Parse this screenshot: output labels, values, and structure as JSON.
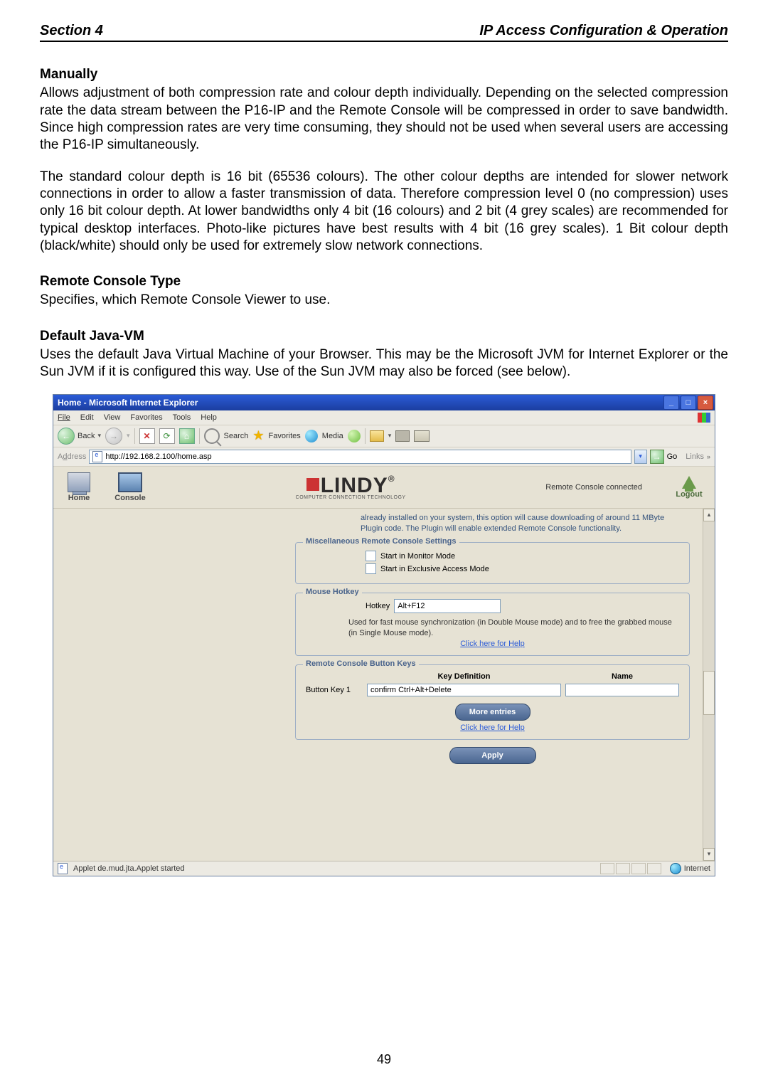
{
  "header": {
    "left": "Section 4",
    "right": "IP Access Configuration & Operation"
  },
  "page_number": "49",
  "sections": {
    "manually": {
      "title": "Manually",
      "para": "Allows adjustment of both compression rate and colour depth individually. Depending on the selected compression rate the data stream between the P16-IP and the Remote Console will be compressed in order to save bandwidth. Since high compression rates are very time consuming, they should not be used when several users are accessing the P16-IP simultaneously.",
      "para2": "The standard colour depth is 16 bit (65536 colours). The other colour depths are intended for slower network connections in order to allow a faster transmission of data. Therefore compression level 0 (no compression) uses only 16 bit colour depth. At lower bandwidths only 4 bit (16 colours) and 2 bit (4 grey scales) are recommended for typical desktop interfaces. Photo-like pictures have best results with 4 bit (16 grey scales). 1 Bit colour depth (black/white) should only be used for extremely slow network connections."
    },
    "remote_console_type": {
      "title": "Remote Console Type",
      "para": "Specifies, which Remote Console Viewer to use."
    },
    "default_java_vm": {
      "title": "Default Java-VM",
      "para": "Uses the default Java Virtual Machine of your Browser. This may be the Microsoft JVM for Internet Explorer or the Sun JVM if it is configured this way. Use of the Sun JVM may also be forced (see below)."
    }
  },
  "browser": {
    "title": "Home - Microsoft Internet Explorer",
    "menus": {
      "file": "File",
      "edit": "Edit",
      "view": "View",
      "favorites": "Favorites",
      "tools": "Tools",
      "help": "Help"
    },
    "toolbar": {
      "back": "Back",
      "search": "Search",
      "favorites": "Favorites",
      "media": "Media"
    },
    "address_label": "Address",
    "address_url": "http://192.168.2.100/home.asp",
    "go": "Go",
    "links": "Links",
    "status": "Applet de.mud.jta.Applet started",
    "zone": "Internet"
  },
  "app": {
    "nav_home": "Home",
    "nav_console": "Console",
    "logo_main": "LINDY",
    "logo_reg": "®",
    "logo_tag": "COMPUTER CONNECTION TECHNOLOGY",
    "conn_status": "Remote Console connected",
    "logout": "Logout",
    "note": "already installed on your system, this option will cause downloading of around 11 MByte Plugin code. The Plugin will enable extended Remote Console functionality.",
    "fs_misc": {
      "legend": "Miscellaneous Remote Console Settings",
      "opt1": "Start in Monitor Mode",
      "opt2": "Start in Exclusive Access Mode"
    },
    "fs_mouse": {
      "legend": "Mouse Hotkey",
      "label": "Hotkey",
      "value": "Alt+F12",
      "hint": "Used for fast mouse synchronization (in Double Mouse mode) and to free the grabbed mouse (in Single Mouse mode).",
      "link": "Click here for Help"
    },
    "fs_keys": {
      "legend": "Remote Console Button Keys",
      "col_key": "Key Definition",
      "col_name": "Name",
      "row_label": "Button Key 1",
      "row_value": "confirm Ctrl+Alt+Delete",
      "more": "More entries",
      "link": "Click here for Help"
    },
    "apply": "Apply"
  }
}
